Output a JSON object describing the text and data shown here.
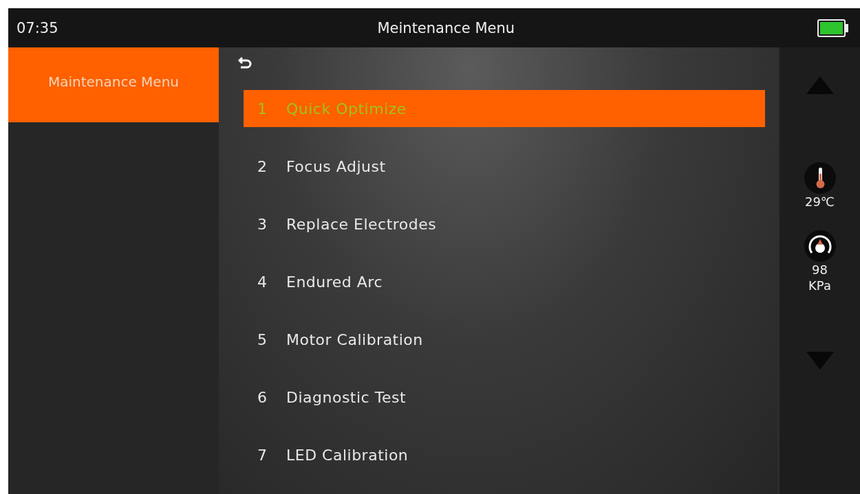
{
  "status_bar": {
    "time": "07:35",
    "title": "Meintenance Menu"
  },
  "sidebar": {
    "items": [
      {
        "label": "Maintenance Menu",
        "selected": true
      }
    ]
  },
  "menu": {
    "items": [
      {
        "number": "1",
        "label": "Quick Optimize",
        "selected": true
      },
      {
        "number": "2",
        "label": "Focus Adjust",
        "selected": false
      },
      {
        "number": "3",
        "label": "Replace Electrodes",
        "selected": false
      },
      {
        "number": "4",
        "label": "Endured Arc",
        "selected": false
      },
      {
        "number": "5",
        "label": "Motor Calibration",
        "selected": false
      },
      {
        "number": "6",
        "label": "Diagnostic Test",
        "selected": false
      },
      {
        "number": "7",
        "label": "LED Calibration",
        "selected": false
      }
    ]
  },
  "side_panel": {
    "temperature": "29℃",
    "pressure_value": "98",
    "pressure_unit": "KPa"
  }
}
